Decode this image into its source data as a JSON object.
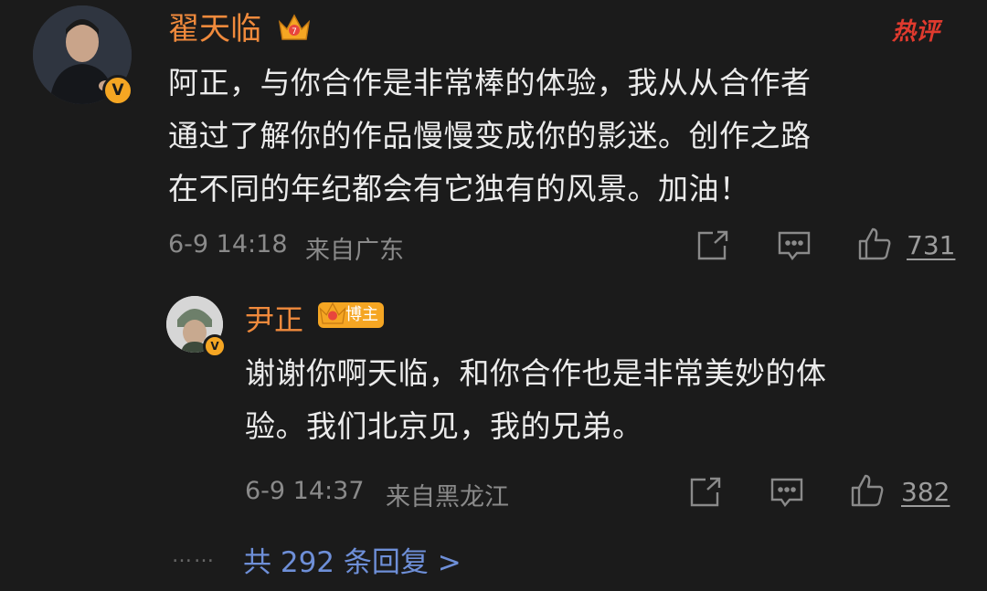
{
  "comment": {
    "author": "翟天临",
    "hot_label": "热评",
    "lines": [
      "阿正，与你合作是非常棒的体验，我从从合作者",
      "通过了解你的作品慢慢变成你的影迷。创作之路",
      "在不同的年纪都会有它独有的风景。加油！"
    ],
    "timestamp": "6-9 14:18",
    "location": "来自广东",
    "likes": "731"
  },
  "reply": {
    "author": "尹正",
    "badge": "博主",
    "lines": [
      "谢谢你啊天临，和你合作也是非常美妙的体",
      "验。我们北京见，我的兄弟。"
    ],
    "timestamp": "6-9 14:37",
    "location": "来自黑龙江",
    "likes": "382"
  },
  "more_replies": {
    "dots": "……",
    "label": "共 292 条回复 >"
  },
  "colors": {
    "background": "#1b1b1b",
    "name": "#f08a3c",
    "link": "#6e8fd8",
    "hot": "#e03a2e",
    "vip": "#f5a623"
  },
  "icons": [
    "crown-icon",
    "verified-icon",
    "share-icon",
    "comment-icon",
    "like-icon"
  ]
}
